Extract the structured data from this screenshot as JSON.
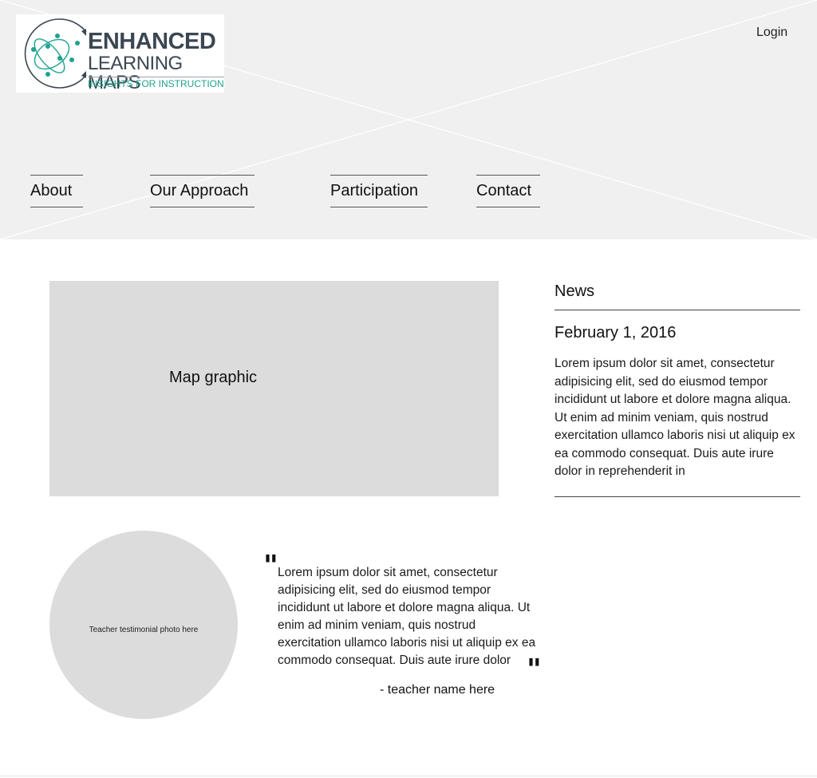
{
  "header": {
    "logo": {
      "line1": "ENHANCED",
      "line2": "LEARNING MAPS",
      "line3": "INSIGHTS FOR INSTRUCTION",
      "color_dark": "#3b4752",
      "color_accent": "#1ea38f"
    },
    "login_label": "Login"
  },
  "nav": {
    "items": [
      {
        "label": "About"
      },
      {
        "label": "Our Approach"
      },
      {
        "label": "Participation"
      },
      {
        "label": "Contact"
      }
    ]
  },
  "main": {
    "map_label": "Map graphic",
    "testimonial": {
      "photo_label": "Teacher testimonial photo here",
      "open_quote": "\"",
      "close_quote": "\"",
      "text": "Lorem ipsum dolor sit amet, consectetur adipisicing elit, sed do eiusmod tempor incididunt ut labore et dolore magna aliqua. Ut enim ad minim veniam, quis nostrud exercitation ullamco laboris nisi ut aliquip ex ea commodo consequat. Duis aute irure dolor",
      "author": "- teacher name here"
    }
  },
  "news": {
    "title": "News",
    "date": "February 1, 2016",
    "body": "Lorem ipsum dolor sit amet, consectetur adipisicing elit, sed do eiusmod tempor incididunt ut labore et dolore magna aliqua. Ut enim ad minim veniam, quis nostrud exercitation ullamco laboris nisi ut aliquip ex ea commodo consequat. Duis aute irure dolor in reprehenderit in"
  },
  "colors": {
    "header_bg": "#f0f0f0",
    "placeholder_bg": "#dcdcdc"
  }
}
